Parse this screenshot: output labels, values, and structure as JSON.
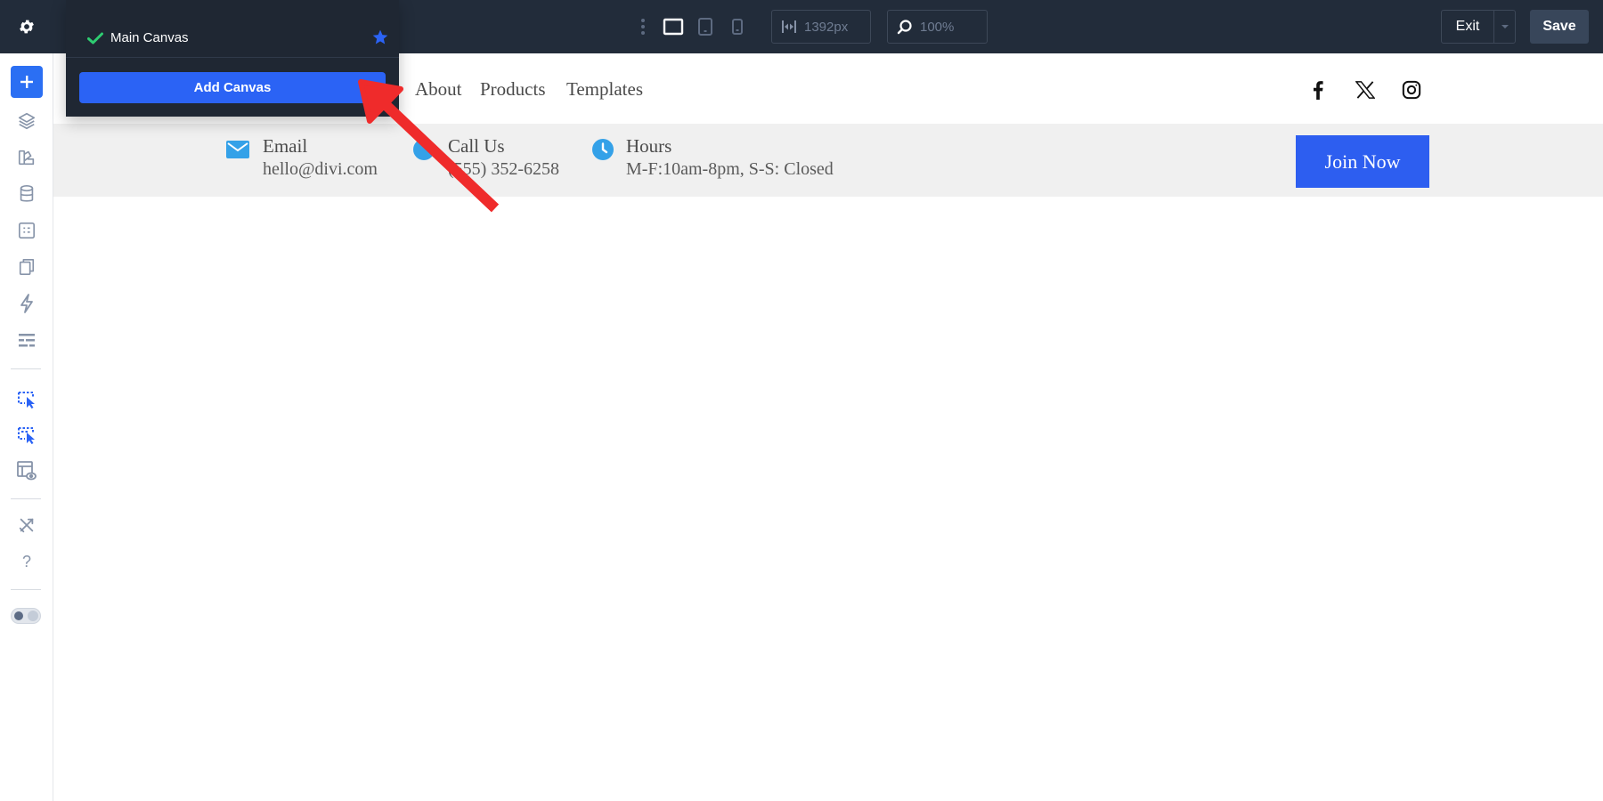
{
  "topbar": {
    "settings_icon": "gear-icon",
    "view_modes": [
      "desktop",
      "tablet",
      "phone"
    ],
    "width_value": "1392px",
    "zoom_value": "100%",
    "exit_label": "Exit",
    "save_label": "Save"
  },
  "canvas_menu": {
    "current_canvas": "Main Canvas",
    "add_canvas_label": "Add Canvas"
  },
  "sidebar": {
    "items": [
      "add-icon",
      "layers-icon",
      "brush-icon",
      "database-icon",
      "form-icon",
      "pages-icon",
      "lightning-icon",
      "list-icon",
      "select-cursor-icon",
      "select-cursor-alt-icon",
      "template-eye-icon",
      "tools-icon",
      "help-icon"
    ],
    "help_label": "?"
  },
  "site": {
    "nav": {
      "links": [
        "About",
        "Products",
        "Templates"
      ],
      "social": [
        "facebook-icon",
        "x-icon",
        "instagram-icon"
      ]
    },
    "info": {
      "email_title": "Email",
      "email_value": "hello@divi.com",
      "call_title": "Call Us",
      "call_value": "(555) 352-6258",
      "hours_title": "Hours",
      "hours_value": "M-F:10am-8pm, S-S: Closed"
    },
    "join_label": "Join Now"
  },
  "colors": {
    "topbar_bg": "#222c3a",
    "accent_blue": "#2b63f5",
    "info_icon_blue": "#34a1e8",
    "check_green": "#2ecc71",
    "arrow_red": "#ef2b2b"
  }
}
